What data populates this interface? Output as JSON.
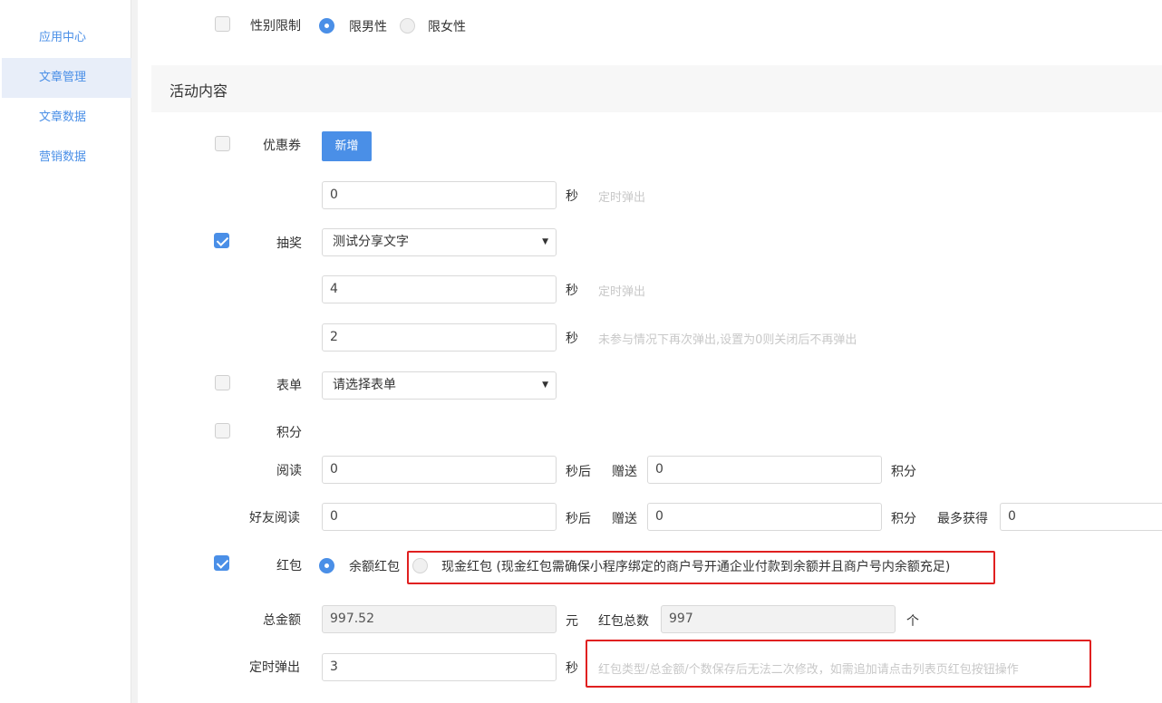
{
  "sidebar": {
    "items": [
      {
        "label": "应用中心"
      },
      {
        "label": "文章管理"
      },
      {
        "label": "文章数据"
      },
      {
        "label": "营销数据"
      }
    ]
  },
  "gender": {
    "label": "性别限制",
    "option_male": "限男性",
    "option_female": "限女性"
  },
  "section": {
    "title": "活动内容"
  },
  "coupon": {
    "label": "优惠券",
    "add_button": "新增",
    "delay_value": "0",
    "delay_unit": "秒",
    "delay_hint": "定时弹出"
  },
  "lottery": {
    "label": "抽奖",
    "selected": "测试分享文字",
    "delay_value": "4",
    "delay_unit": "秒",
    "delay_hint": "定时弹出",
    "repeat_value": "2",
    "repeat_unit": "秒",
    "repeat_hint": "未参与情况下再次弹出,设置为0则关闭后不再弹出"
  },
  "form": {
    "label": "表单",
    "placeholder": "请选择表单"
  },
  "points": {
    "label": "积分",
    "read_label": "阅读",
    "read_value": "0",
    "read_unit": "秒后",
    "read_give": "赠送",
    "read_points": "0",
    "read_points_unit": "积分",
    "friend_label": "好友阅读",
    "friend_value": "0",
    "friend_unit": "秒后",
    "friend_give": "赠送",
    "friend_points": "0",
    "friend_points_unit": "积分",
    "max_label": "最多获得",
    "max_value": "0"
  },
  "redpacket": {
    "label": "红包",
    "option_balance": "余额红包",
    "option_cash": "现金红包 (现金红包需确保小程序绑定的商户号开通企业付款到余额并且商户号内余额充足)",
    "total_label": "总金额",
    "total_value": "997.52",
    "total_unit": "元",
    "count_label": "红包总数",
    "count_value": "997",
    "count_unit": "个",
    "timer_label": "定时弹出",
    "timer_value": "3",
    "timer_unit": "秒",
    "note": "红包类型/总金额/个数保存后无法二次修改，如需追加请点击列表页红包按钮操作"
  },
  "colors": {
    "accent": "#4a8fe7",
    "highlight": "#e02020"
  }
}
